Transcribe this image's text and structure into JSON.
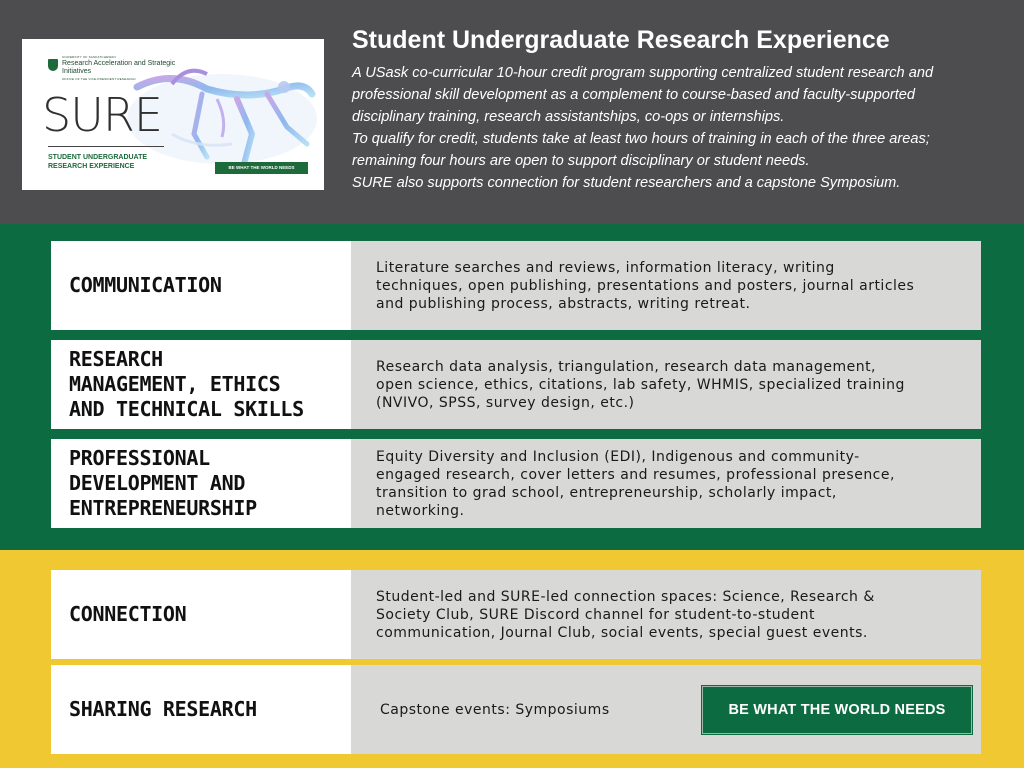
{
  "logo": {
    "unit_small": "UNIVERSITY OF SASKATCHEWAN",
    "unit": "Research Acceleration and Strategic Initiatives",
    "unit_office": "OFFICE OF THE VICE-PRESIDENT RESEARCH",
    "wordmark": "SURE",
    "subtitle": "STUDENT UNDERGRADUATE RESEARCH EXPERIENCE",
    "tagline": "BE WHAT THE WORLD NEEDS"
  },
  "header": {
    "title": "Student Undergraduate Research Experience",
    "intro_lines": [
      "A USask co-curricular 10-hour credit program supporting centralized student research and",
      "professional skill development as a complement to course-based and faculty-supported",
      "disciplinary training, research assistantships, co-ops or internships.",
      "To qualify for credit, students take at least two hours of training in each of the three areas;",
      "remaining four hours are open to support disciplinary or student needs.",
      "SURE also supports connection for student researchers and a capstone Symposium."
    ]
  },
  "areas": [
    {
      "label": "COMMUNICATION",
      "description": "Literature searches and reviews, information literacy, writing\ntechniques, open publishing, presentations and posters, journal articles\nand publishing process, abstracts, writing retreat."
    },
    {
      "label": "RESEARCH\nMANAGEMENT, ETHICS\nAND TECHNICAL SKILLS",
      "description": "Research data analysis, triangulation, research data management,\nopen science, ethics, citations, lab safety, WHMIS, specialized training\n(NVIVO, SPSS, survey design, etc.)"
    },
    {
      "label": "PROFESSIONAL\nDEVELOPMENT AND\nENTREPRENEURSHIP",
      "description": "Equity Diversity and Inclusion (EDI), Indigenous and community-\nengaged research, cover letters and resumes, professional presence,\ntransition to grad school, entrepreneurship, scholarly impact,\nnetworking."
    }
  ],
  "extras": [
    {
      "label": "CONNECTION",
      "description": "Student-led and SURE-led connection spaces: Science, Research &\nSociety Club, SURE Discord channel for student-to-student\ncommunication, Journal Club, social events, special guest events."
    },
    {
      "label": "SHARING RESEARCH",
      "description": "Capstone events: Symposiums"
    }
  ],
  "badge": {
    "text": "BE WHAT THE WORLD NEEDS"
  },
  "colors": {
    "header_bg": "#4d4d4f",
    "green": "#0d6b41",
    "yellow": "#f0c832",
    "label_bg": "#ffffff",
    "desc_bg": "#d8d8d6"
  }
}
